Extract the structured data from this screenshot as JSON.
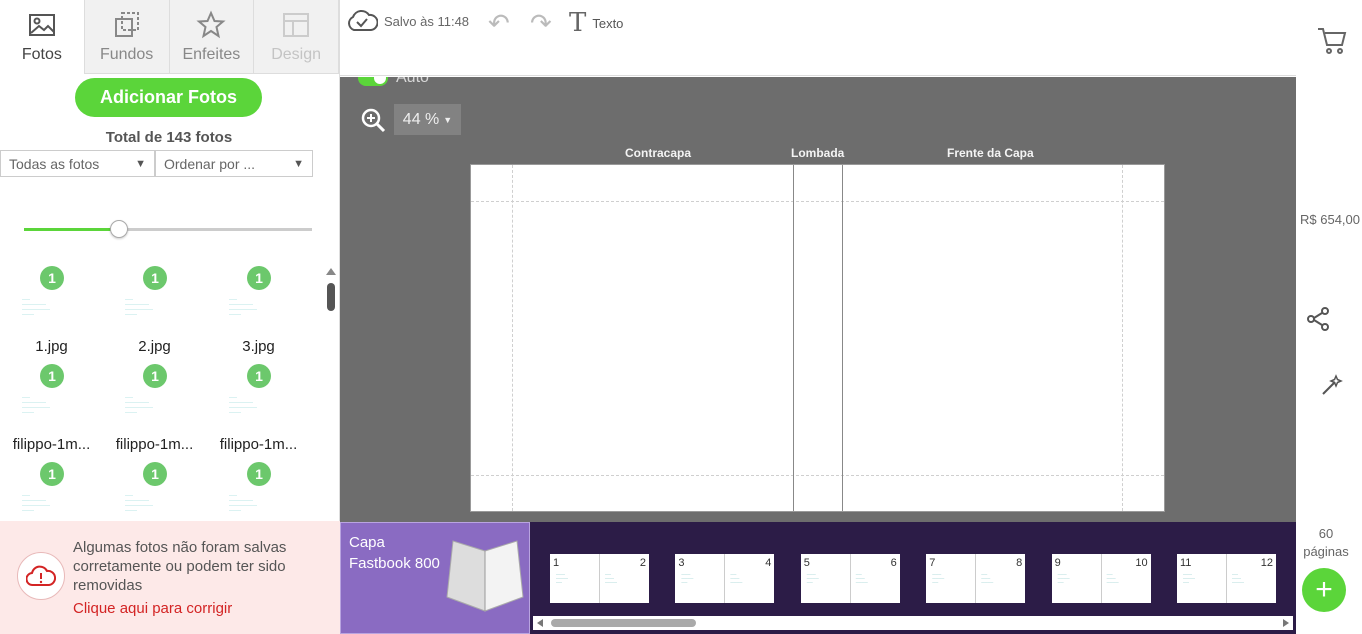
{
  "tabs": [
    {
      "label": "Fotos",
      "icon": "image-icon"
    },
    {
      "label": "Fundos",
      "icon": "background-icon"
    },
    {
      "label": "Enfeites",
      "icon": "star-icon"
    },
    {
      "label": "Design",
      "icon": "layout-icon"
    }
  ],
  "left": {
    "add_photos_label": "Adicionar Fotos",
    "total_label": "Total de 143 fotos",
    "filter_value": "Todas as fotos",
    "sort_value": "Ordenar por ...",
    "slider_fraction": 0.33,
    "photos": [
      {
        "name": "1.jpg",
        "count": "1"
      },
      {
        "name": "2.jpg",
        "count": "1"
      },
      {
        "name": "3.jpg",
        "count": "1"
      },
      {
        "name": "filippo-1m...",
        "count": "1"
      },
      {
        "name": "filippo-1m...",
        "count": "1"
      },
      {
        "name": "filippo-1m...",
        "count": "1"
      },
      {
        "name": "",
        "count": "1"
      },
      {
        "name": "",
        "count": "1"
      },
      {
        "name": "",
        "count": "1"
      }
    ],
    "warning_text": "Algumas fotos não foram salvas corretamente ou podem ter sido removidas",
    "warning_link": "Clique aqui para corrigir"
  },
  "toolbar": {
    "saved_label": "Salvo às 11:48",
    "text_label": "Texto"
  },
  "canvas": {
    "auto_label": "Auto",
    "zoom_value": "44 %",
    "labels": {
      "back_cover": "Contracapa",
      "spine": "Lombada",
      "front_cover": "Frente da Capa"
    }
  },
  "strip": {
    "cover_line1": "Capa",
    "cover_line2": "Fastbook 800",
    "spreads": [
      {
        "left": "1",
        "right": "2"
      },
      {
        "left": "3",
        "right": "4"
      },
      {
        "left": "5",
        "right": "6"
      },
      {
        "left": "7",
        "right": "8"
      },
      {
        "left": "9",
        "right": "10"
      },
      {
        "left": "11",
        "right": "12"
      }
    ]
  },
  "rail": {
    "price": "R$ 654,00",
    "pages_count": "60",
    "pages_label": "páginas"
  },
  "colors": {
    "accent_green": "#5bd53a",
    "purple_dark": "#2c1c47",
    "purple_light": "#8a6bc2",
    "warning_red": "#d32424"
  }
}
